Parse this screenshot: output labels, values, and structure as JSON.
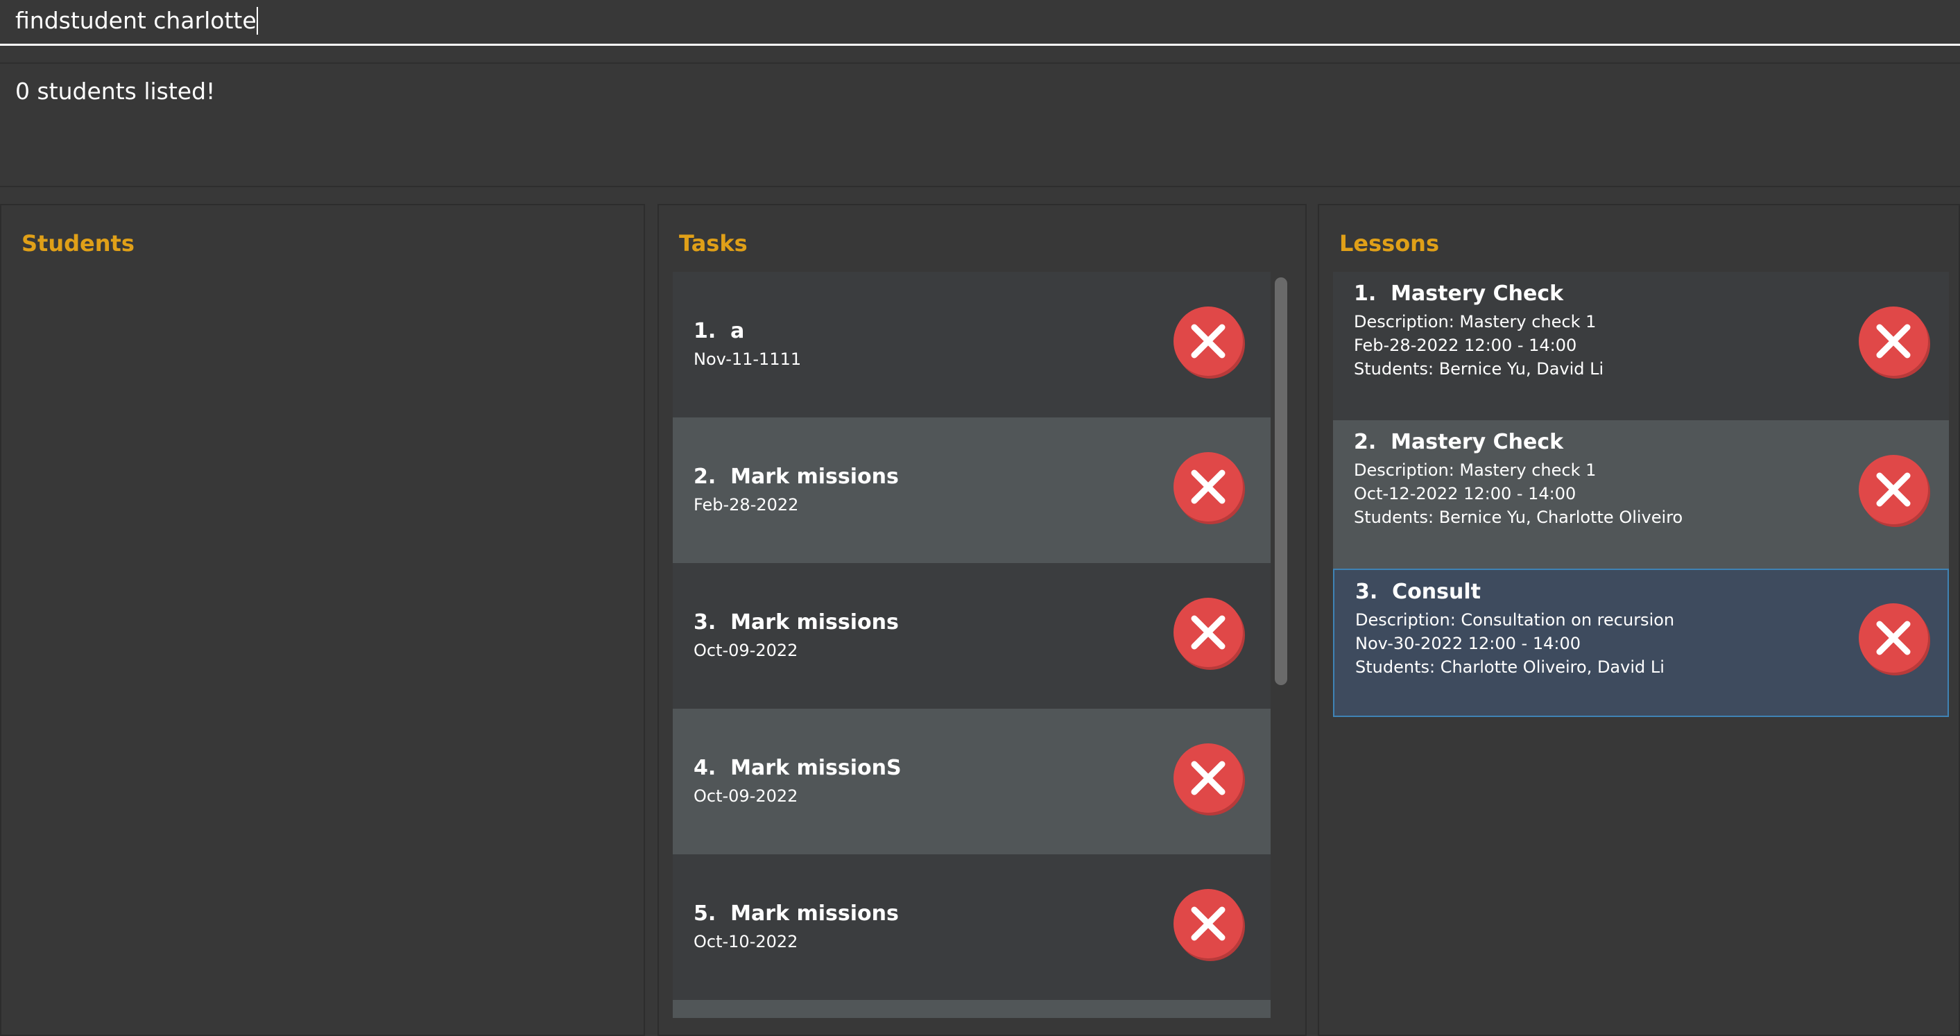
{
  "command": {
    "value": "findstudent charlotte"
  },
  "result": {
    "message": "0 students listed!"
  },
  "students_panel": {
    "title": "Students"
  },
  "tasks_panel": {
    "title": "Tasks",
    "items": [
      {
        "index": "1.",
        "name": "a",
        "date": "Nov-11-1111"
      },
      {
        "index": "2.",
        "name": "Mark missions",
        "date": "Feb-28-2022"
      },
      {
        "index": "3.",
        "name": "Mark missions",
        "date": "Oct-09-2022"
      },
      {
        "index": "4.",
        "name": "Mark missionS",
        "date": "Oct-09-2022"
      },
      {
        "index": "5.",
        "name": "Mark missions",
        "date": "Oct-10-2022"
      }
    ]
  },
  "lessons_panel": {
    "title": "Lessons",
    "items": [
      {
        "index": "1.",
        "name": "Mastery Check",
        "description": "Description: Mastery check 1",
        "time": "Feb-28-2022 12:00 - 14:00",
        "students": "Students: Bernice Yu, David Li"
      },
      {
        "index": "2.",
        "name": "Mastery Check",
        "description": "Description: Mastery check 1",
        "time": "Oct-12-2022 12:00 - 14:00",
        "students": "Students: Bernice Yu, Charlotte Oliveiro"
      },
      {
        "index": "3.",
        "name": "Consult",
        "description": "Description: Consultation on recursion",
        "time": "Nov-30-2022 12:00 - 14:00",
        "students": "Students: Charlotte Oliveiro, David Li"
      }
    ]
  },
  "icons": {
    "delete": "close-circle-icon"
  },
  "colors": {
    "background": "#383838",
    "panel_title": "#e0a018",
    "delete_button": "#e04848",
    "row_dark": "#3b3d3f",
    "row_light": "#515658",
    "selected_row": "#3e4b5e",
    "selected_border": "#3f83b5"
  }
}
